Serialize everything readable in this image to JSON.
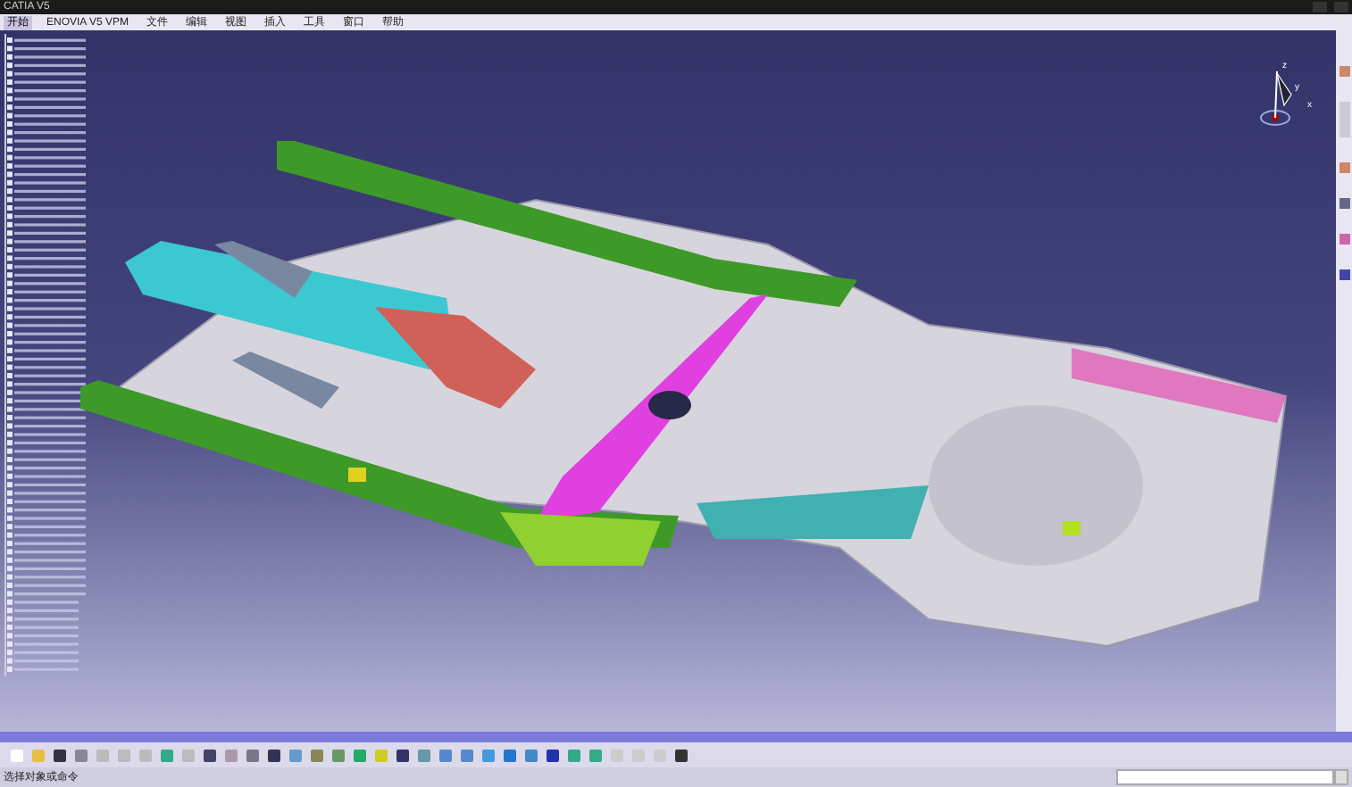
{
  "window": {
    "title": "CATIA V5"
  },
  "menu": [
    {
      "label": "开始",
      "selected": true
    },
    {
      "label": "ENOVIA V5 VPM",
      "selected": false
    },
    {
      "label": "文件",
      "selected": false
    },
    {
      "label": "编辑",
      "selected": false
    },
    {
      "label": "视图",
      "selected": false
    },
    {
      "label": "插入",
      "selected": false
    },
    {
      "label": "工具",
      "selected": false
    },
    {
      "label": "窗口",
      "selected": false
    },
    {
      "label": "帮助",
      "selected": false
    }
  ],
  "compass": {
    "axes": [
      "z",
      "y",
      "x"
    ]
  },
  "status_bar": {
    "message": "选择对象或命令"
  }
}
